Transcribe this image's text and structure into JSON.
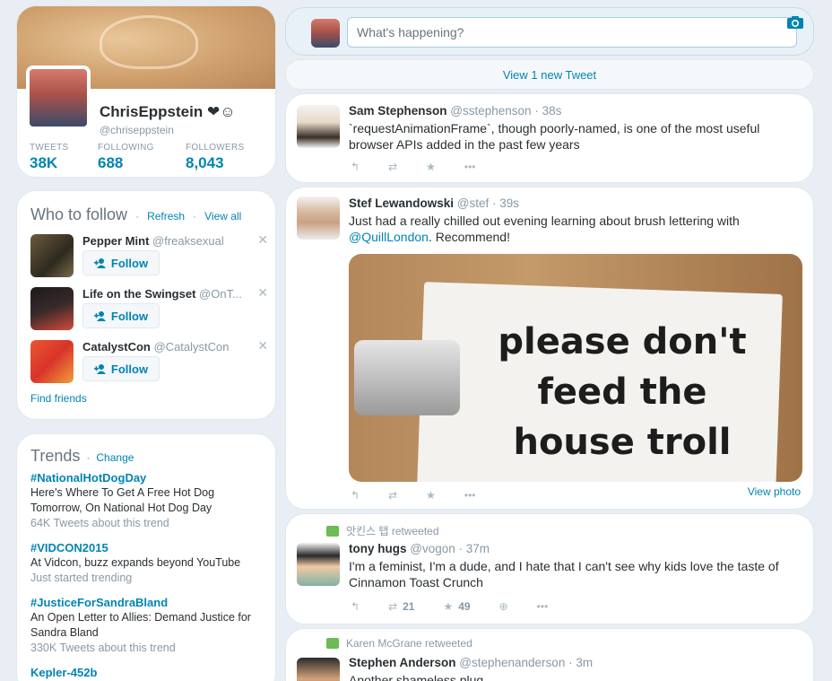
{
  "profile": {
    "name": "ChrisEppstein ❤☺",
    "handle": "@chriseppstein",
    "stats": [
      {
        "label": "TWEETS",
        "value": "38K"
      },
      {
        "label": "FOLLOWING",
        "value": "688"
      },
      {
        "label": "FOLLOWERS",
        "value": "8,043"
      }
    ]
  },
  "who_to_follow": {
    "title": "Who to follow",
    "refresh": "Refresh",
    "view_all": "View all",
    "follow_label": "Follow",
    "users": [
      {
        "name": "Pepper Mint",
        "handle": "@freaksexual"
      },
      {
        "name": "Life on the Swingset",
        "handle": "@OnT..."
      },
      {
        "name": "CatalystCon",
        "handle": "@CatalystCon"
      }
    ],
    "find_friends": "Find friends"
  },
  "trends": {
    "title": "Trends",
    "change": "Change",
    "items": [
      {
        "name": "#NationalHotDogDay",
        "desc": "Here's Where To Get A Free Hot Dog Tomorrow, On National Hot Dog Day",
        "meta": "64K Tweets about this trend"
      },
      {
        "name": "#VIDCON2015",
        "desc": "At Vidcon, buzz expands beyond YouTube",
        "meta": "Just started trending"
      },
      {
        "name": "#JusticeForSandraBland",
        "desc": "An Open Letter to Allies: Demand Justice for Sandra Bland",
        "meta": "330K Tweets about this trend"
      },
      {
        "name": "Kepler-452b",
        "desc": "",
        "meta": ""
      }
    ]
  },
  "compose": {
    "placeholder": "What's happening?"
  },
  "new_tweets": "View 1 new Tweet",
  "tweets": [
    {
      "name": "Sam Stephenson",
      "handle": "@sstephenson",
      "time": "· 38s",
      "text": "`requestAnimationFrame`, though poorly-named, is one of the most useful browser APIs added in the past few years"
    },
    {
      "name": "Stef Lewandowski",
      "handle": "@stef",
      "time": "· 39s",
      "text_before": "Just had a really chilled out evening learning about brush lettering with ",
      "mention": "@QuillLondon",
      "text_after": ". Recommend!",
      "photo_lines": [
        "please don't",
        "feed the",
        "house troll"
      ],
      "view_photo": "View photo"
    },
    {
      "retweeted_by": "앗킨스 탭 retweeted",
      "name": "tony hugs",
      "handle": "@vogon",
      "time": "· 37m",
      "text": "I'm a feminist, I'm a dude, and I hate that I can't see why kids love the taste of Cinnamon Toast Crunch",
      "retweets": "21",
      "favorites": "49"
    },
    {
      "retweeted_by": "Karen McGrane retweeted",
      "name": "Stephen Anderson",
      "handle": "@stephenanderson",
      "time": "· 3m",
      "text": "Another shameless plug"
    }
  ],
  "colors": {
    "link": "#0084b4",
    "muted": "#8899a6",
    "retweet_green": "#6dbb52"
  }
}
